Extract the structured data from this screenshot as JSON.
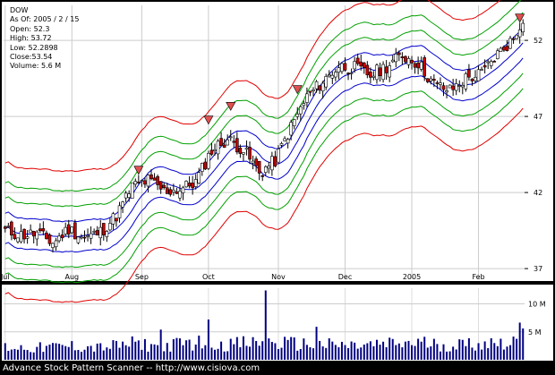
{
  "header": {
    "symbol": "DOW",
    "as_of": "As Of: 2005 / 2 / 15",
    "open": "Open: 52.3",
    "high": "High: 53.72",
    "low": "Low: 52.2898",
    "close": "Close:53.54",
    "volume": "Volume: 5.6 M"
  },
  "footer_text": "Advance Stock Pattern Scanner -- http://www.cisiova.com",
  "colors": {
    "band_inner": "#0000cc",
    "band_mid": "#00a000",
    "band_outer": "#e00000",
    "candle": "#000000",
    "bearish_fill": "#cc0000",
    "volume_bar": "#000080",
    "signal": "#e05050"
  },
  "chart_data": {
    "type": "candlestick",
    "price_axis": {
      "ticks": [
        37,
        42,
        47,
        52
      ],
      "ylim": [
        36.3,
        54.3
      ]
    },
    "volume_axis": {
      "ticks": [
        "5 M",
        "10 M"
      ],
      "ylim": [
        0,
        12.8
      ]
    },
    "x_tick_labels": [
      "Jul",
      "Aug",
      "Sep",
      "Oct",
      "Nov",
      "Dec",
      "2005",
      "Feb"
    ],
    "x_tick_index": [
      0,
      21,
      43,
      64,
      86,
      107,
      128,
      149
    ],
    "trading_days": 164,
    "close_points": [
      [
        0,
        39.5
      ],
      [
        5,
        39.2
      ],
      [
        10,
        39.3
      ],
      [
        15,
        38.7
      ],
      [
        20,
        39.6
      ],
      [
        25,
        39.0
      ],
      [
        30,
        39.4
      ],
      [
        35,
        40.5
      ],
      [
        40,
        42.4
      ],
      [
        45,
        42.8
      ],
      [
        50,
        42.1
      ],
      [
        55,
        42.2
      ],
      [
        60,
        42.7
      ],
      [
        65,
        44.8
      ],
      [
        70,
        45.5
      ],
      [
        75,
        44.8
      ],
      [
        80,
        43.3
      ],
      [
        85,
        44.1
      ],
      [
        90,
        46.3
      ],
      [
        95,
        48.3
      ],
      [
        100,
        49.3
      ],
      [
        105,
        50.3
      ],
      [
        110,
        50.2
      ],
      [
        115,
        49.7
      ],
      [
        120,
        50.3
      ],
      [
        125,
        51.0
      ],
      [
        130,
        50.5
      ],
      [
        135,
        49.1
      ],
      [
        140,
        48.7
      ],
      [
        145,
        49.5
      ],
      [
        150,
        49.8
      ],
      [
        155,
        51.1
      ],
      [
        160,
        52.1
      ],
      [
        163,
        53.5
      ]
    ],
    "volume_points": [
      [
        0,
        2.4
      ],
      [
        10,
        2.2
      ],
      [
        20,
        2.6
      ],
      [
        30,
        2.3
      ],
      [
        40,
        3.0
      ],
      [
        50,
        2.6
      ],
      [
        60,
        3.3
      ],
      [
        70,
        2.9
      ],
      [
        80,
        3.2
      ],
      [
        90,
        3.0
      ],
      [
        100,
        2.8
      ],
      [
        110,
        2.6
      ],
      [
        120,
        2.9
      ],
      [
        130,
        3.2
      ],
      [
        140,
        2.7
      ],
      [
        150,
        3.1
      ],
      [
        160,
        3.5
      ],
      [
        163,
        5.6
      ]
    ],
    "volume_spikes": [
      [
        82,
        12.4
      ],
      [
        64,
        7.2
      ],
      [
        49,
        5.4
      ],
      [
        98,
        5.9
      ]
    ],
    "band_offsets": [
      1.0,
      2.0,
      3.0,
      4.3
    ],
    "sell_signals": [
      {
        "index": 42,
        "price": 43.2
      },
      {
        "index": 64,
        "price": 46.5
      },
      {
        "index": 71,
        "price": 47.4
      },
      {
        "index": 92,
        "price": 48.5
      },
      {
        "index": 162,
        "price": 53.2
      }
    ]
  }
}
